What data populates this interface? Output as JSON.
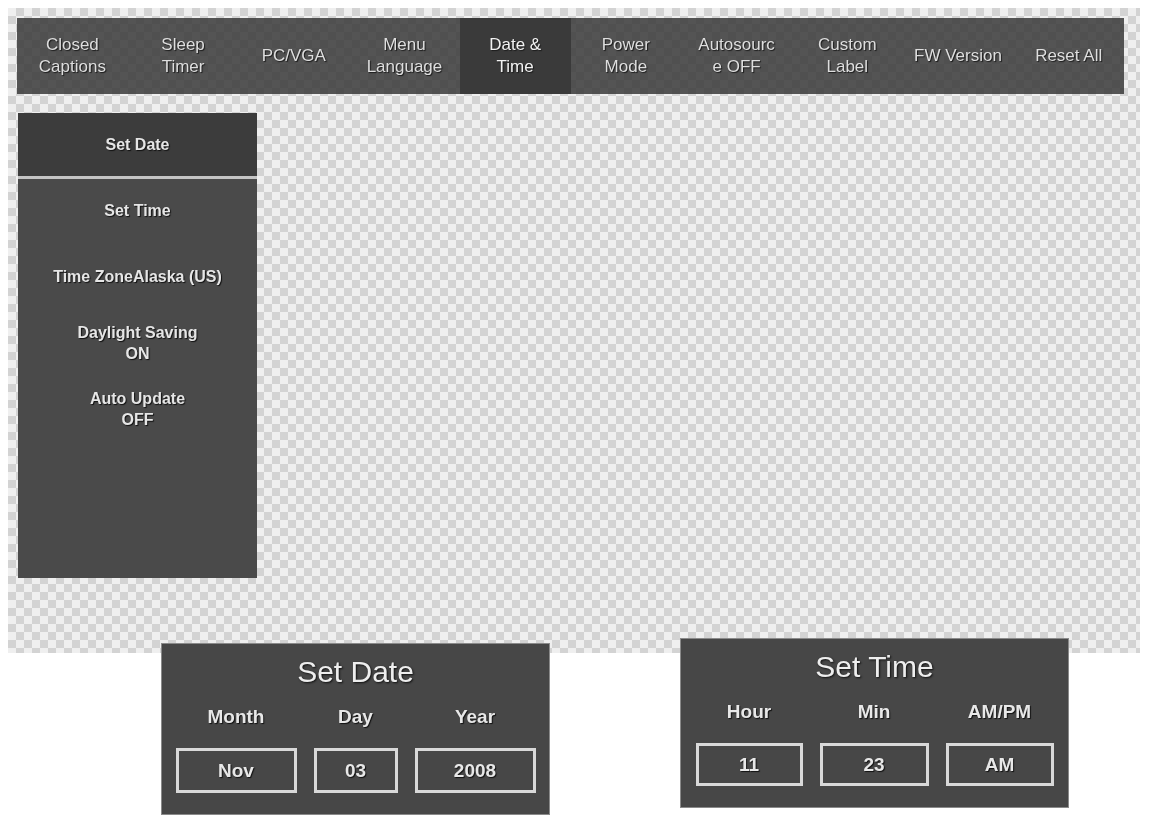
{
  "menu_tabs": [
    {
      "label": "Closed\nCaptions",
      "selected": false
    },
    {
      "label": "Sleep\nTimer",
      "selected": false
    },
    {
      "label": "PC/VGA",
      "selected": false
    },
    {
      "label": "Menu\nLanguage",
      "selected": false
    },
    {
      "label": "Date &\nTime",
      "selected": true
    },
    {
      "label": "Power\nMode",
      "selected": false
    },
    {
      "label": "Autosourc\ne OFF",
      "selected": false
    },
    {
      "label": "Custom\nLabel",
      "selected": false
    },
    {
      "label": "FW Version",
      "selected": false
    },
    {
      "label": "Reset All",
      "selected": false
    }
  ],
  "sidebar": {
    "items": [
      {
        "label": "Set Date",
        "selected": true
      },
      {
        "label": "Set Time",
        "selected": false
      },
      {
        "label": "Time ZoneAlaska (US)",
        "selected": false
      },
      {
        "label": "Daylight Saving",
        "value": "ON",
        "selected": false
      },
      {
        "label": "Auto Update",
        "value": "OFF",
        "selected": false
      }
    ]
  },
  "dialogs": [
    {
      "title": "Set Date",
      "fields": [
        {
          "label": "Month",
          "value": "Nov"
        },
        {
          "label": "Day",
          "value": "03"
        },
        {
          "label": "Year",
          "value": "2008"
        }
      ]
    },
    {
      "title": "Set Time",
      "fields": [
        {
          "label": "Hour",
          "value": "11"
        },
        {
          "label": "Min",
          "value": "23"
        },
        {
          "label": "AM/PM",
          "value": "AM"
        }
      ]
    }
  ]
}
